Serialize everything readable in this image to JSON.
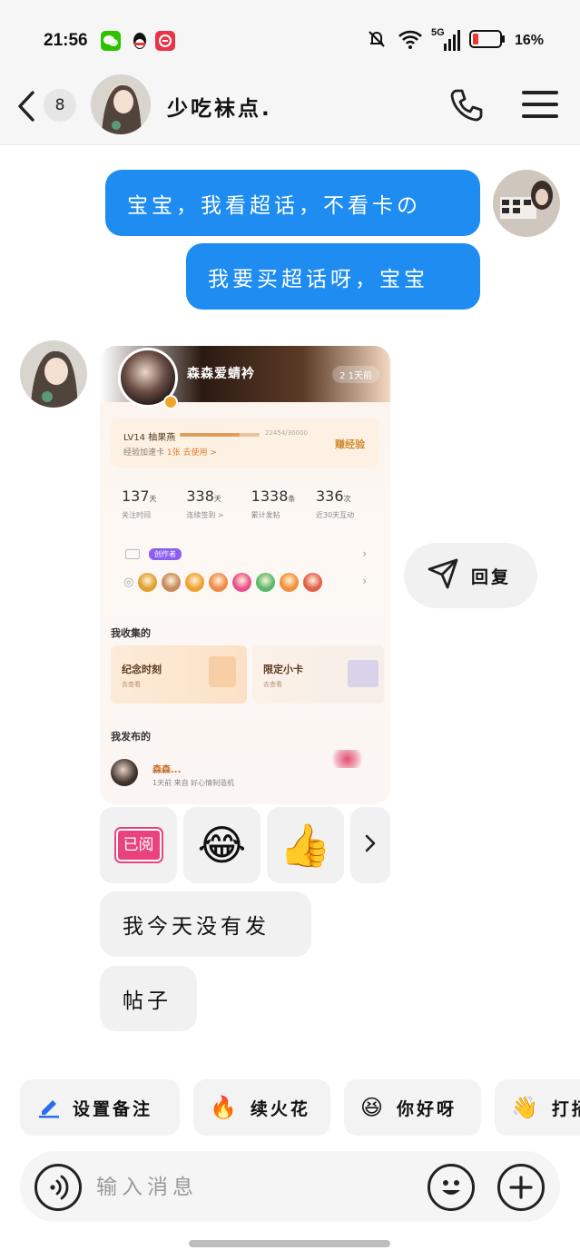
{
  "status_bar": {
    "time": "21:56",
    "network": "5G",
    "battery": "16%",
    "icons": [
      "wechat-icon",
      "qq-icon",
      "app-icon",
      "mute-icon",
      "wifi-icon",
      "signal-icon",
      "battery-icon"
    ]
  },
  "header": {
    "unread_count": "8",
    "contact_name": "少吃袜点.",
    "icons": [
      "back-icon",
      "phone-icon",
      "menu-icon"
    ]
  },
  "messages": {
    "outgoing": [
      "宝宝，我看超话，不看卡の",
      "我要买超话呀，宝宝"
    ],
    "incoming_text": [
      "我今天没有发",
      "帖子"
    ]
  },
  "shared_card": {
    "name": "森森爱蜻衿",
    "days": "2 1天前",
    "level": {
      "label": "LV14 柚果燕",
      "progress_text": "22454/30000",
      "progress": 0.75,
      "sub_text": "经验加速卡",
      "sub_link": "1张 去使用 >",
      "button": "赚经验"
    },
    "stats": [
      {
        "num": "137",
        "unit": "天",
        "label": "关注时间"
      },
      {
        "num": "338",
        "unit": "天",
        "label": "连续签到 >"
      },
      {
        "num": "1338",
        "unit": "条",
        "label": "累计发帖"
      },
      {
        "num": "336",
        "unit": "次",
        "label": "近30天互动"
      }
    ],
    "creator_tag": "创作者",
    "medal_colors": [
      "#e0a030",
      "#c88a5c",
      "#f0a030",
      "#f08a48",
      "#e8508a",
      "#5ab868",
      "#f0903a",
      "#e0604a"
    ],
    "collections_title": "我收集的",
    "collections": [
      {
        "title": "纪念时刻",
        "sub": "去查看"
      },
      {
        "title": "限定小卡",
        "sub": "去查看"
      }
    ],
    "posts_title": "我发布的",
    "post": {
      "author": "森森...",
      "meta": "1天前    来自 好心情制造机"
    }
  },
  "reactions": {
    "read_label": "已阅",
    "laugh_emoji": "😂",
    "thumb_emoji": "👍",
    "more": "›"
  },
  "reply": {
    "label": "回复"
  },
  "quick_actions": [
    {
      "emoji": "✏️",
      "label": "设置备注"
    },
    {
      "emoji": "🔥",
      "label": "续火花"
    },
    {
      "emoji": "😆",
      "label": "你好呀"
    },
    {
      "emoji": "👋",
      "label": "打招呼"
    }
  ],
  "input": {
    "placeholder": "输入消息"
  },
  "colors": {
    "outgoing_bubble": "#1e8cf0",
    "incoming_bubble": "#f1f1f1",
    "read_stamp": "#e8437e"
  }
}
